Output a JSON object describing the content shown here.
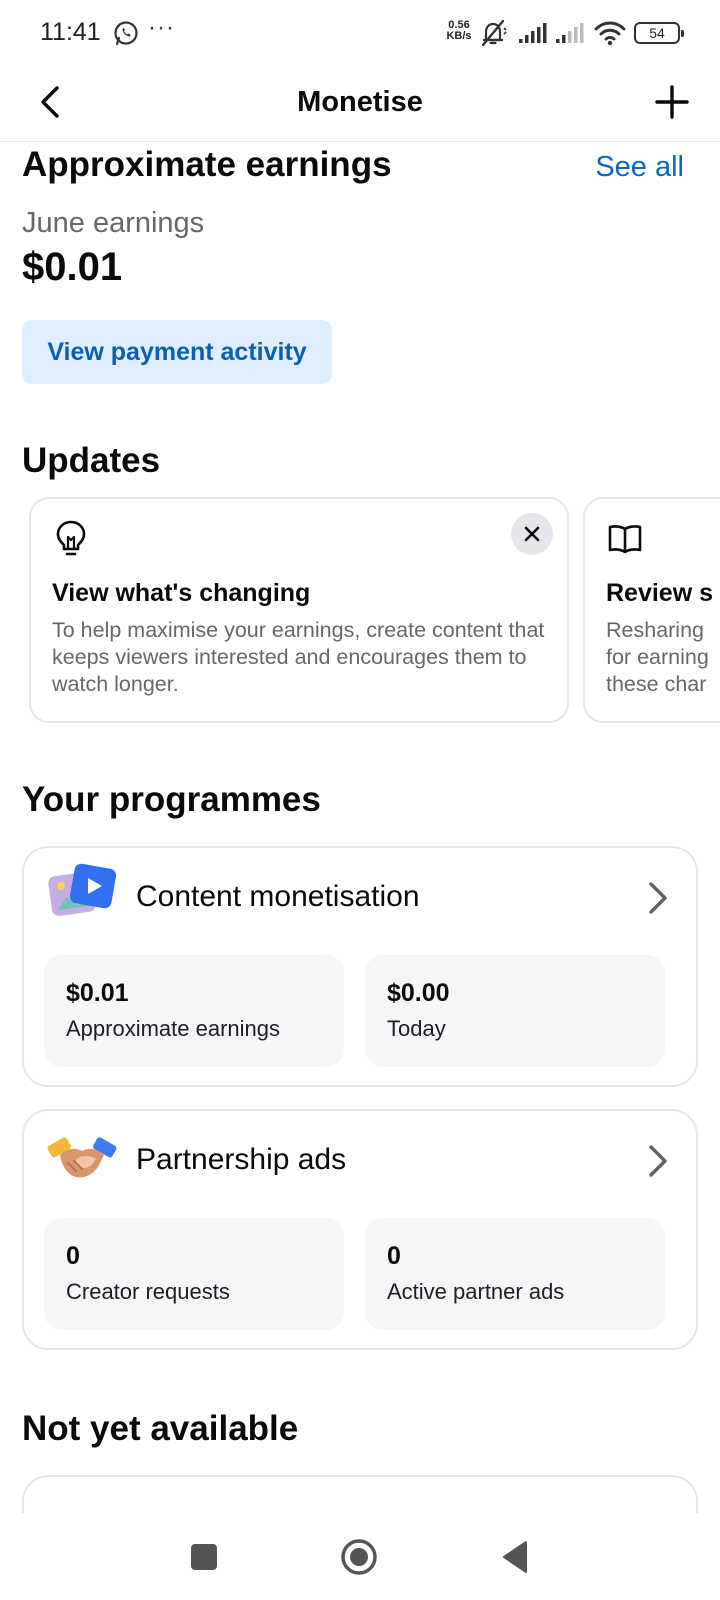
{
  "status_bar": {
    "time": "11:41",
    "more": "···",
    "speed_value": "0.56",
    "speed_unit": "KB/s",
    "battery": "54"
  },
  "header": {
    "title": "Monetise"
  },
  "earnings": {
    "title": "Approximate earnings",
    "see_all": "See all",
    "period_label": "June earnings",
    "amount": "$0.01",
    "payment_button": "View payment activity"
  },
  "updates": {
    "title": "Updates",
    "cards": [
      {
        "icon": "lightbulb-icon",
        "title": "View what's changing",
        "body": "To help maximise your earnings, create content that keeps viewers interested and encourages them to watch longer."
      },
      {
        "icon": "book-icon",
        "title": "Review s",
        "body_lines": [
          "Resharing",
          "for earning",
          "these char"
        ]
      }
    ]
  },
  "programmes": {
    "title": "Your programmes",
    "items": [
      {
        "title": "Content monetisation",
        "icon": "content-monetisation-icon",
        "stats": [
          {
            "value": "$0.01",
            "label": "Approximate earnings"
          },
          {
            "value": "$0.00",
            "label": "Today"
          }
        ]
      },
      {
        "title": "Partnership ads",
        "icon": "handshake-icon",
        "stats": [
          {
            "value": "0",
            "label": "Creator requests"
          },
          {
            "value": "0",
            "label": "Active partner ads"
          }
        ]
      }
    ]
  },
  "not_available": {
    "title": "Not yet available"
  },
  "colors": {
    "accent_link": "#0866c6",
    "button_bg": "#deeefc",
    "card_border": "#e4e6eb",
    "stat_bg": "#f5f6f8",
    "muted_text": "#65676b"
  }
}
